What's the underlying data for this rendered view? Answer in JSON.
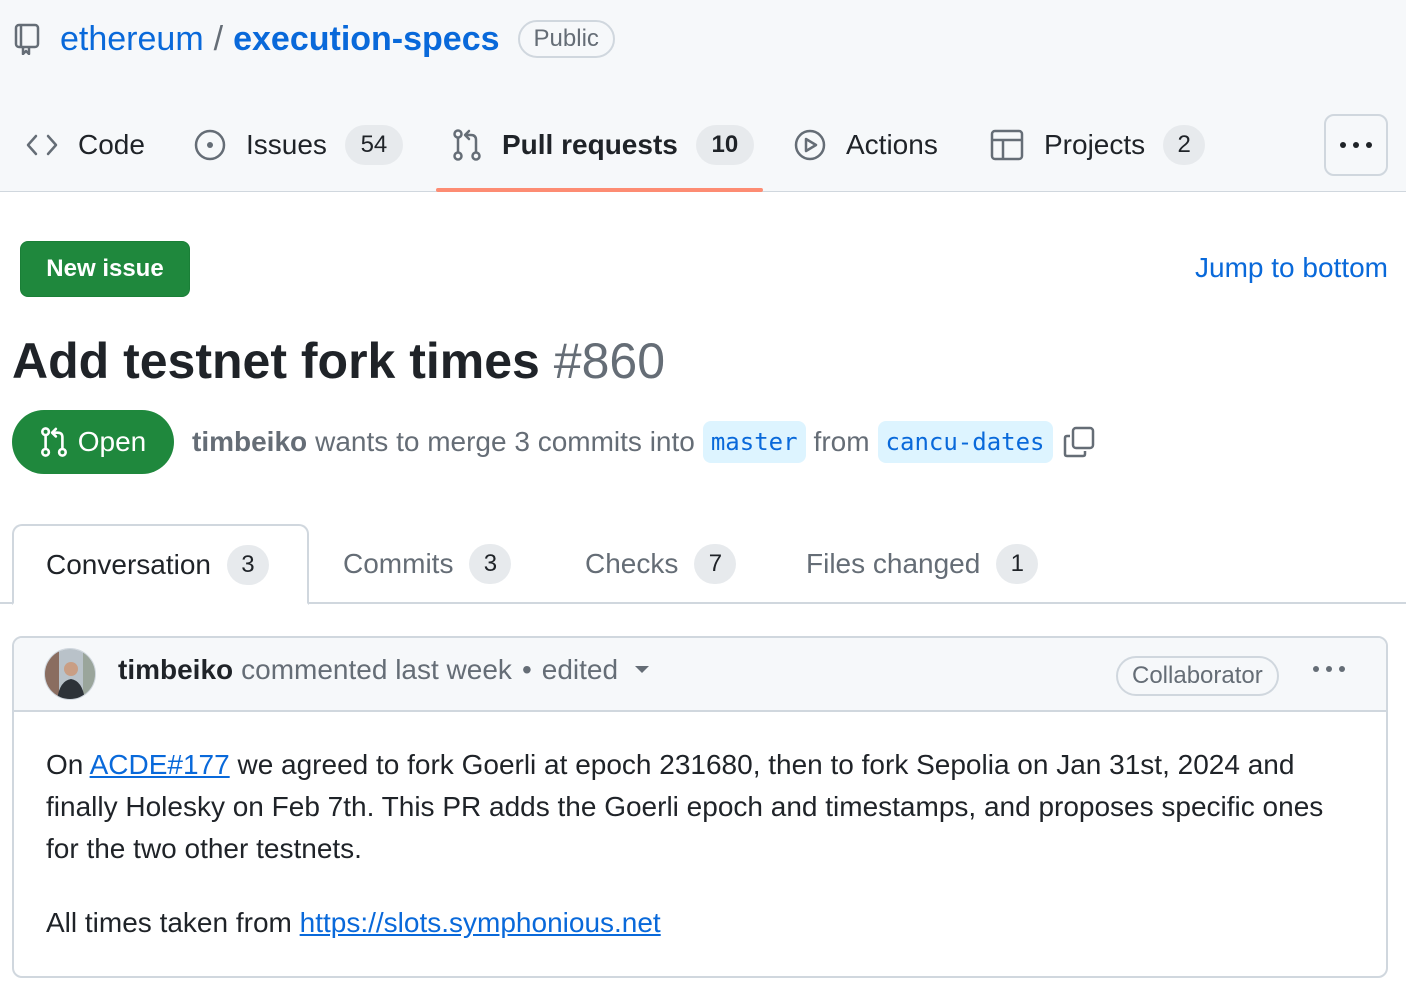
{
  "repo": {
    "owner": "ethereum",
    "separator": "/",
    "name": "execution-specs",
    "visibility": "Public"
  },
  "nav": {
    "items": [
      {
        "label": "Code",
        "icon": "code-icon"
      },
      {
        "label": "Issues",
        "icon": "issue-icon",
        "count": "54"
      },
      {
        "label": "Pull requests",
        "icon": "pull-request-icon",
        "count": "10",
        "selected": true
      },
      {
        "label": "Actions",
        "icon": "play-icon"
      },
      {
        "label": "Projects",
        "icon": "table-icon",
        "count": "2"
      }
    ],
    "more_icon": "kebab-horizontal-icon",
    "underline_color": "#fd8c73"
  },
  "toolbar": {
    "new_issue_label": "New issue",
    "jump_label": "Jump to bottom"
  },
  "pr": {
    "title": "Add testnet fork times",
    "number": "#860",
    "state": "Open",
    "state_color": "#1f883d",
    "author": "timbeiko",
    "merge_text": "wants to merge 3 commits into",
    "base_branch": "master",
    "from_text": "from",
    "head_branch": "cancu-dates"
  },
  "tabs": [
    {
      "label": "Conversation",
      "count": "3",
      "active": true
    },
    {
      "label": "Commits",
      "count": "3"
    },
    {
      "label": "Checks",
      "count": "7"
    },
    {
      "label": "Files changed",
      "count": "1"
    }
  ],
  "comment": {
    "author": "timbeiko",
    "meta": "commented last week",
    "dot": "•",
    "edited": "edited",
    "role": "Collaborator",
    "body": {
      "p1_prefix": "On ",
      "p1_link": "ACDE#177",
      "p1_rest": " we agreed to fork Goerli at epoch 231680, then to fork Sepolia on Jan 31st, 2024 and finally Holesky on Feb 7th. This PR adds the Goerli epoch and timestamps, and proposes specific ones for the two other testnets.",
      "p2_prefix": "All times taken from ",
      "p2_link": "https://slots.symphonious.net"
    }
  },
  "colors": {
    "link": "#0969da",
    "primary_button": "#1f883d",
    "border": "#d0d7de",
    "muted": "#656d76"
  }
}
